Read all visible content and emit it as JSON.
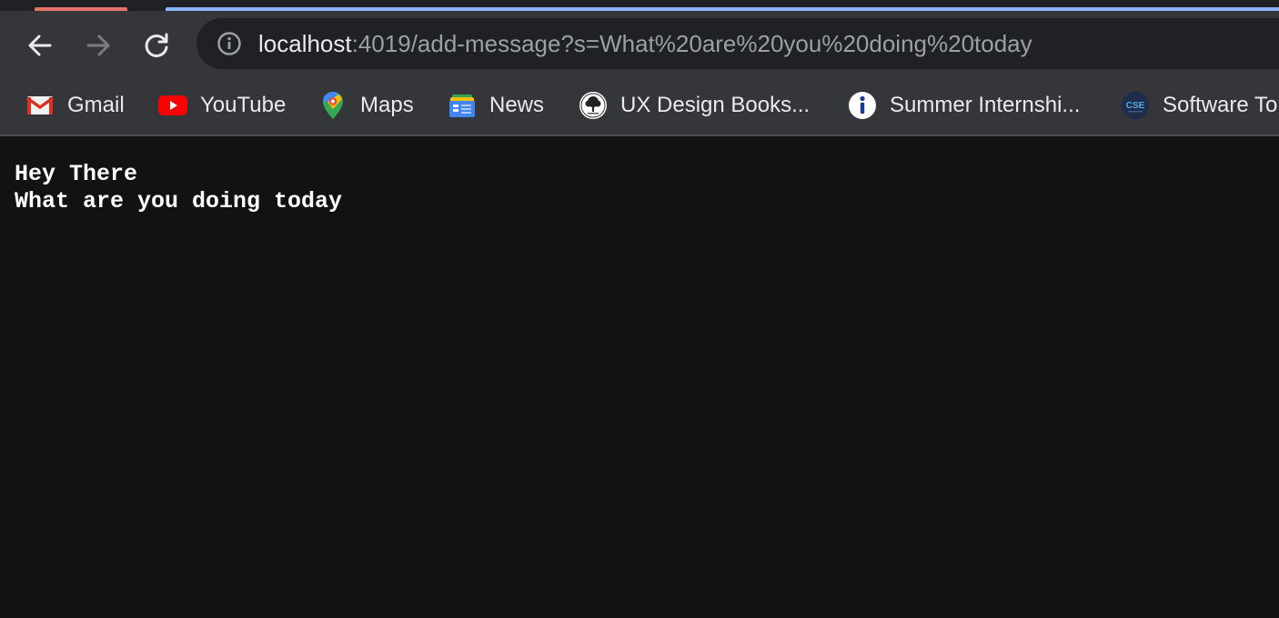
{
  "browser": {
    "address_bar": {
      "host": "localhost",
      "rest": ":4019/add-message?s=What%20are%20you%20doing%20today"
    },
    "bookmarks": [
      {
        "label": "Gmail",
        "icon": "gmail-icon"
      },
      {
        "label": "YouTube",
        "icon": "youtube-icon"
      },
      {
        "label": "Maps",
        "icon": "maps-icon"
      },
      {
        "label": "News",
        "icon": "news-icon"
      },
      {
        "label": "UX Design Books...",
        "icon": "tree-logo-icon"
      },
      {
        "label": "Summer Internshi...",
        "icon": "info-icon"
      },
      {
        "label": "Software To",
        "icon": "cse-logo-icon"
      }
    ],
    "cse_logo_text": "CSE"
  },
  "page": {
    "messages": [
      "Hey There",
      "What are you doing today"
    ]
  },
  "colors": {
    "chrome_bg": "#35363a",
    "omnibox_bg": "#202124",
    "page_bg": "#121212",
    "text": "#e8eaed",
    "muted_text": "#9aa0a6"
  }
}
